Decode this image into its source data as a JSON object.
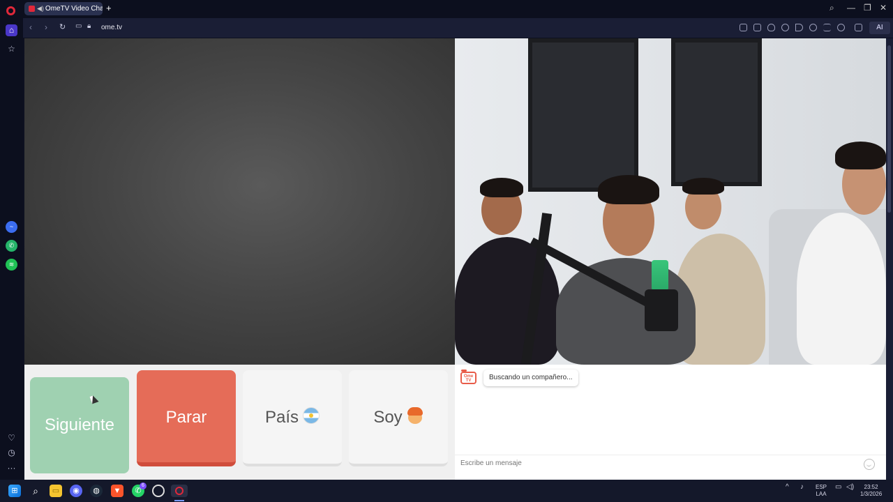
{
  "browser": {
    "tab_title": "OmeTV Video Chat —",
    "url": "ome.tv",
    "ai_label": "AI"
  },
  "controls": {
    "next_label": "Siguiente",
    "stop_label": "Parar",
    "country_label": "País",
    "gender_label": "Soy"
  },
  "chat": {
    "logo_text": "Ome TV",
    "status_message": "Buscando un compañero...",
    "input_placeholder": "Escribe un mensaje"
  },
  "taskbar": {
    "language": "ESP",
    "layout": "LAA",
    "time": "23:52",
    "date": "1/3/2026",
    "whatsapp_badge": "6"
  },
  "icons": [
    "opera-logo-icon",
    "home-icon",
    "star-icon",
    "messenger-icon",
    "whatsapp-icon",
    "spotify-icon",
    "heart-icon",
    "history-icon",
    "more-icon",
    "search-icon",
    "emoji-icon"
  ],
  "colors": {
    "next_button": "#9fd1b1",
    "stop_button": "#e56c58",
    "opera_red": "#e0283a"
  }
}
